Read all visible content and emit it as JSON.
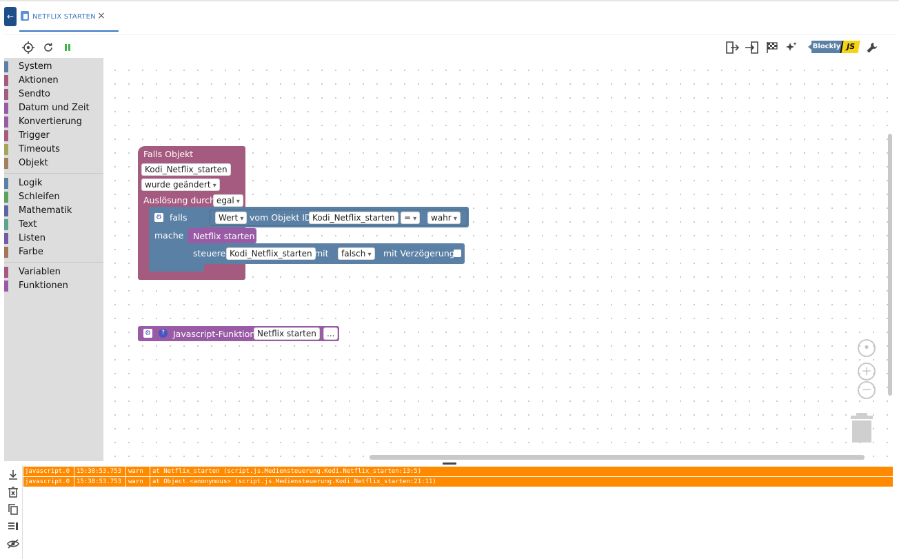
{
  "tab": {
    "title": "NETFLIX STARTEN",
    "close": "×",
    "back": "←"
  },
  "toolbar": {
    "left_icons": [
      "target-icon",
      "refresh-icon",
      "pause-icon"
    ],
    "right_icons": [
      "export-icon",
      "import-icon",
      "flag-icon",
      "sparkle-icon",
      "blockly-js-badge",
      "wrench-icon"
    ],
    "badge_left": "Blockly",
    "badge_right": "JS"
  },
  "palette": {
    "groups": [
      [
        {
          "label": "System",
          "color": "#5b80a5"
        },
        {
          "label": "Aktionen",
          "color": "#a55b80"
        },
        {
          "label": "Sendto",
          "color": "#a55b80"
        },
        {
          "label": "Datum und Zeit",
          "color": "#995ba5"
        },
        {
          "label": "Konvertierung",
          "color": "#995ba5"
        },
        {
          "label": "Trigger",
          "color": "#a55b80"
        },
        {
          "label": "Timeouts",
          "color": "#a5a55b"
        },
        {
          "label": "Objekt",
          "color": "#a5805b"
        }
      ],
      [
        {
          "label": "Logik",
          "color": "#5b80a5"
        },
        {
          "label": "Schleifen",
          "color": "#5ba55b"
        },
        {
          "label": "Mathematik",
          "color": "#5b67a5"
        },
        {
          "label": "Text",
          "color": "#5ba58c"
        },
        {
          "label": "Listen",
          "color": "#745ba5"
        },
        {
          "label": "Farbe",
          "color": "#a5745b"
        }
      ],
      [
        {
          "label": "Variablen",
          "color": "#a55b80"
        },
        {
          "label": "Funktionen",
          "color": "#995ba5"
        }
      ]
    ]
  },
  "blocks": {
    "trigger": {
      "title": "Falls Objekt",
      "object_id": "Kodi_Netflix_starten",
      "condition": "wurde geändert",
      "ack_label": "Auslösung durch",
      "ack_value": "egal",
      "color": "#a55b80"
    },
    "if_block": {
      "if_label": "falls",
      "do_label": "mache",
      "color": "#5b80a5",
      "compare": {
        "value_label": "Wert",
        "of_object_label": "vom Objekt ID",
        "object_id": "Kodi_Netflix_starten",
        "operator": "=",
        "value": "wahr"
      }
    },
    "call": {
      "label": "Netflix starten",
      "color": "#995ba5"
    },
    "control": {
      "label": "steuere",
      "object_id": "Kodi_Netflix_starten",
      "with_label": "mit",
      "value": "falsch",
      "delay_label": "mit Verzögerung"
    },
    "function_def": {
      "label": "Javascript-Funktion",
      "name": "Netflix starten",
      "more": "...",
      "help": "?",
      "color": "#995ba5"
    }
  },
  "log": {
    "rows": [
      {
        "source": "javascript.0",
        "time": "15:38:53.753",
        "level": "warn",
        "message": "at Netflix_starten (script.js.Mediensteuerung.Kodi.Netflix_starten:13:5)"
      },
      {
        "source": "javascript.0",
        "time": "15:38:53.753",
        "level": "warn",
        "message": "at Object.<anonymous> (script.js.Mediensteuerung.Kodi.Netflix_starten:21:11)"
      }
    ],
    "row_color": "#ff8a00"
  }
}
